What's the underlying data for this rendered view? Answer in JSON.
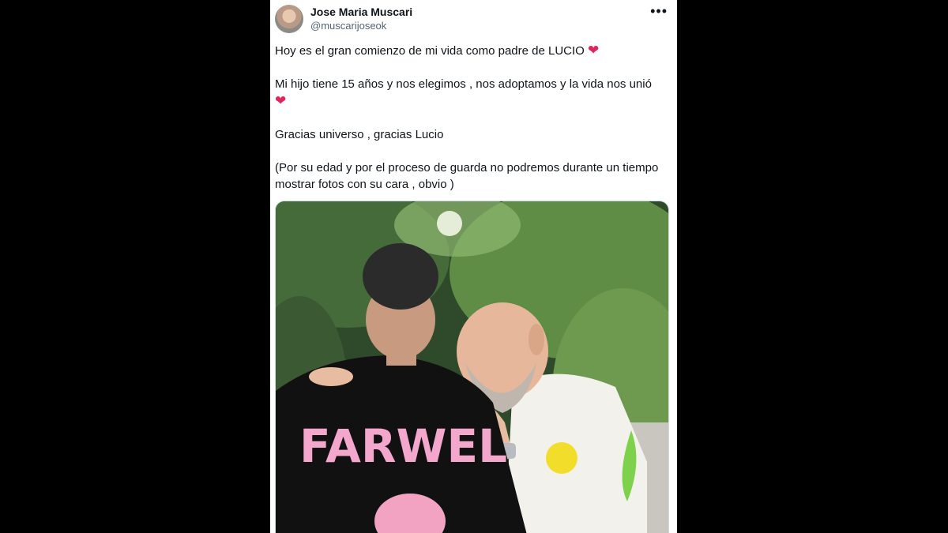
{
  "tweet": {
    "author_name": "Jose Maria Muscari",
    "author_handle": "@muscarijoseok",
    "more_icon": "•••",
    "lines": [
      "Hoy es el gran comienzo de mi vida como padre de LUCIO",
      "Mi hijo tiene 15 años y nos elegimos , nos adoptamos  y la vida nos unió",
      "Gracias universo , gracias Lucio",
      "(Por su edad y por el proceso de guarda no podremos durante un tiempo mostrar fotos con su cara , obvio )"
    ],
    "heart_emoji": "❤",
    "shirt_text": "FARWEL"
  },
  "colors": {
    "background": "#000000",
    "card": "#ffffff",
    "text": "#0f1419",
    "secondary_text": "#536471",
    "heart": "#e0245e"
  }
}
